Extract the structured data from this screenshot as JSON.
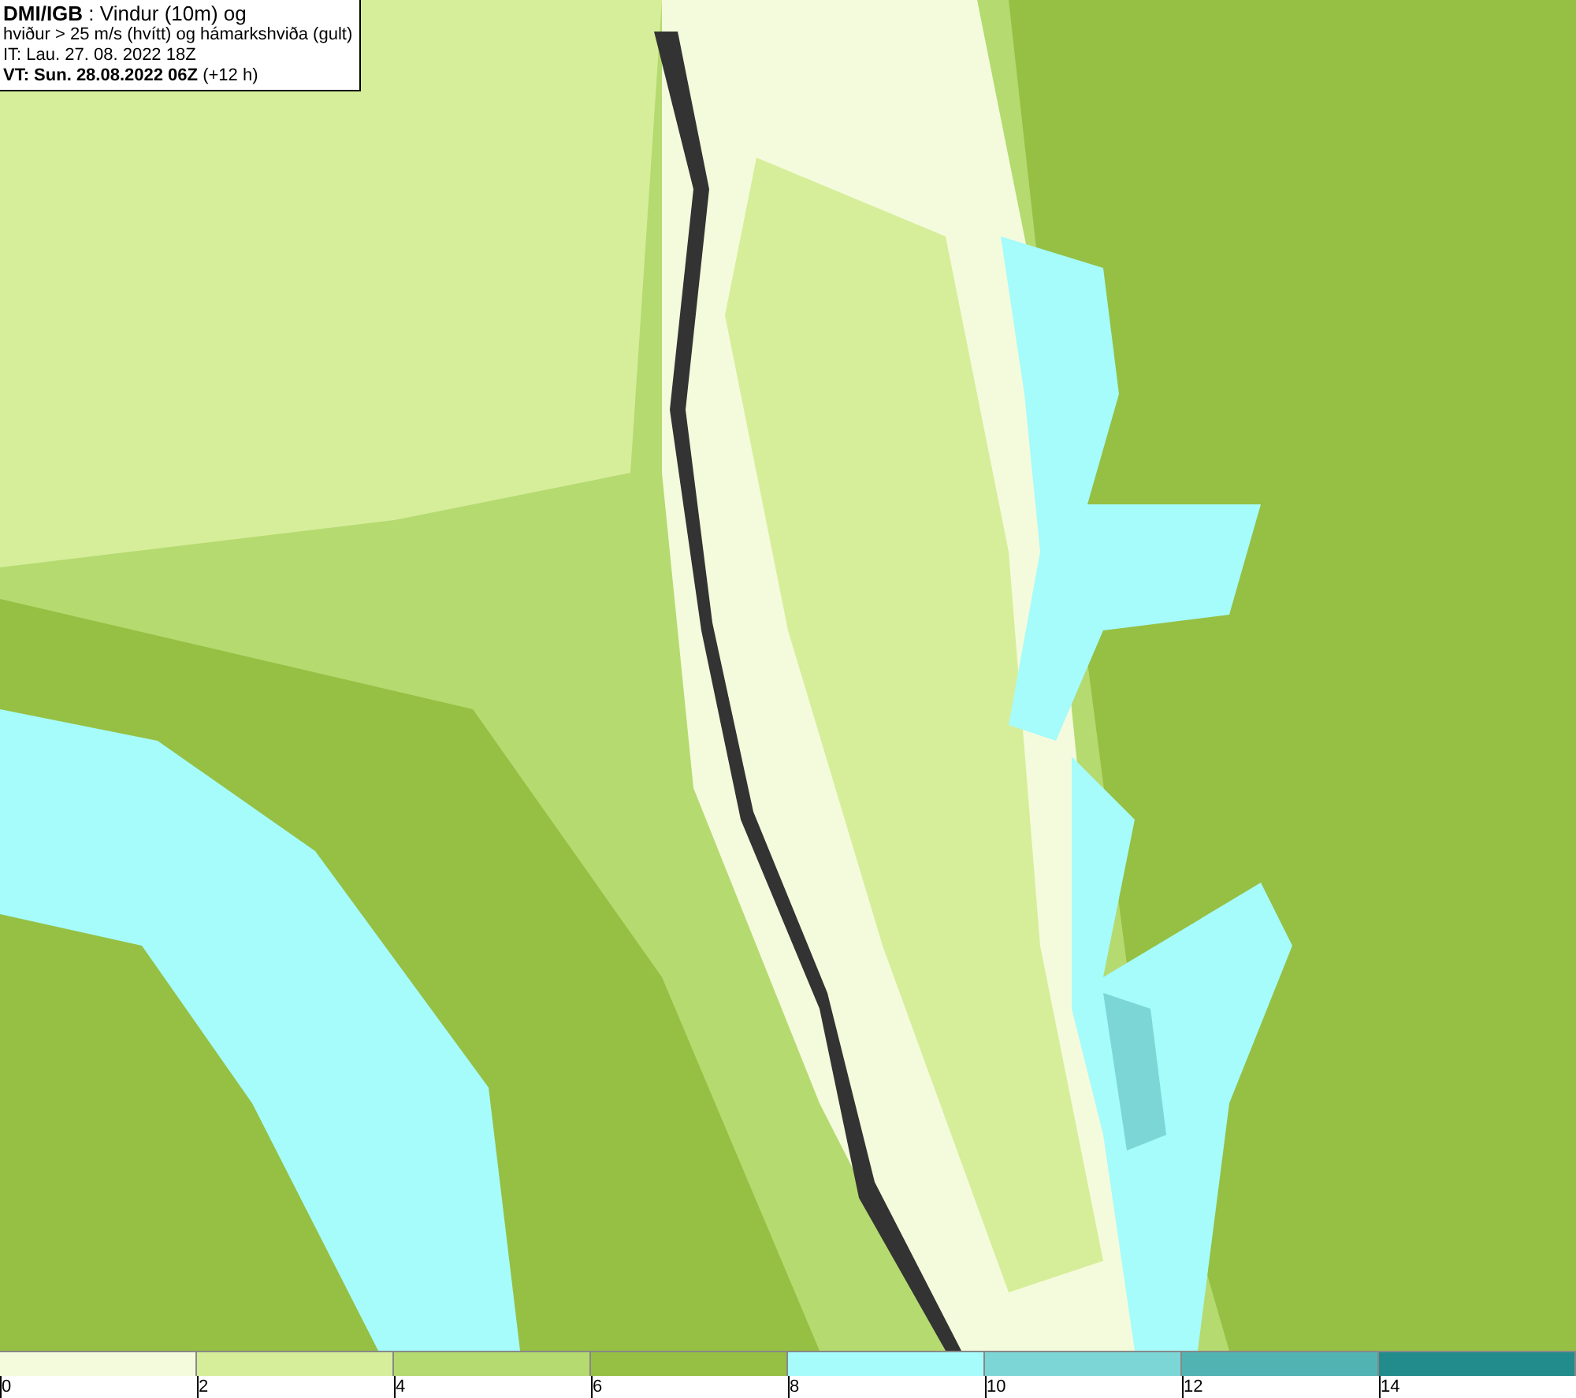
{
  "info_box": {
    "lines": [
      "**DMI/IGB** : Vindur (10m) og",
      "hviður > 25 m/s (hvítt) og hámarkshviða (gult)",
      "IT: Lau. 27. 08. 2022 18Z",
      "**VT: Sun. 28.08.2022 06Z** (+12 h)"
    ]
  },
  "legend": {
    "bins": [
      {
        "color": "#f4fbdc"
      },
      {
        "color": "#d6ee9a"
      },
      {
        "color": "#b5da70"
      },
      {
        "color": "#95c043"
      },
      {
        "color": "#a6fbfb"
      },
      {
        "color": "#7dd6d6"
      },
      {
        "color": "#52b3b3"
      },
      {
        "color": "#228c8c"
      }
    ],
    "ticks": [
      "0",
      "2",
      "4",
      "6",
      "8",
      "10",
      "12",
      "14"
    ]
  }
}
